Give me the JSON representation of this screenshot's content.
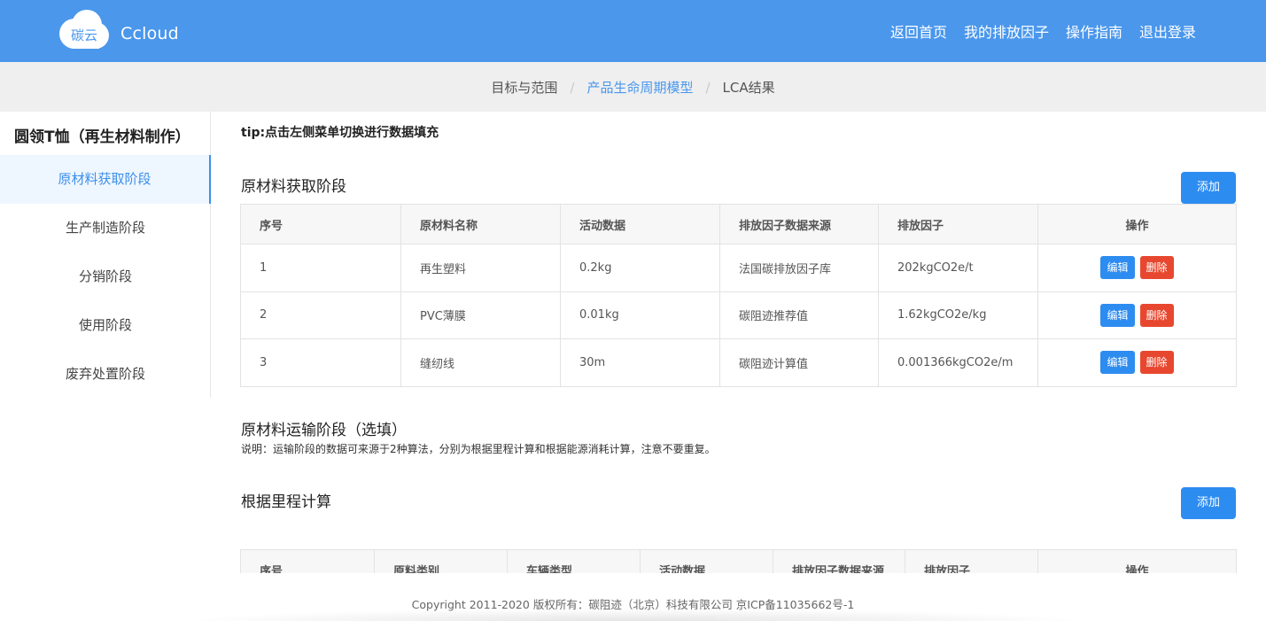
{
  "header": {
    "logo_text": "碳云",
    "brand": "Ccloud",
    "nav": [
      "返回首页",
      "我的排放因子",
      "操作指南",
      "退出登录"
    ]
  },
  "breadcrumb": {
    "items": [
      "目标与范围",
      "产品生命周期模型",
      "LCA结果"
    ],
    "active_index": 1
  },
  "sidebar": {
    "product_title": "圆领T恤（再生材料制作）",
    "items": [
      "原材料获取阶段",
      "生产制造阶段",
      "分销阶段",
      "使用阶段",
      "废弃处置阶段"
    ],
    "active_index": 0
  },
  "main": {
    "tip": "tip:点击左侧菜单切换进行数据填充",
    "section1": {
      "title": "原材料获取阶段",
      "add_label": "添加",
      "headers": [
        "序号",
        "原材料名称",
        "活动数据",
        "排放因子数据来源",
        "排放因子",
        "操作"
      ],
      "rows": [
        [
          "1",
          "再生塑料",
          "0.2kg",
          "法国碳排放因子库",
          "202kgCO2e/t"
        ],
        [
          "2",
          "PVC薄膜",
          "0.01kg",
          "碳阻迹推荐值",
          "1.62kgCO2e/kg"
        ],
        [
          "3",
          "缝纫线",
          "30m",
          "碳阻迹计算值",
          "0.001366kgCO2e/m"
        ]
      ],
      "edit_label": "编辑",
      "delete_label": "删除"
    },
    "section2": {
      "title": "原材料运输阶段（选填）",
      "desc": "说明：运输阶段的数据可来源于2种算法，分别为根据里程计算和根据能源消耗计算，注意不要重复。"
    },
    "section3": {
      "title": "根据里程计算",
      "add_label": "添加",
      "headers": [
        "序号",
        "原料类别",
        "车辆类型",
        "活动数据",
        "排放因子数据来源",
        "排放因子",
        "操作"
      ]
    }
  },
  "footer": {
    "copyright": "Copyright 2011-2020 版权所有：碳阻迹（北京）科技有限公司 京ICP备11035662号-1"
  },
  "colors": {
    "header_bg": "#4a97ec",
    "accent": "#2d8cf0",
    "danger": "#e8472f"
  }
}
